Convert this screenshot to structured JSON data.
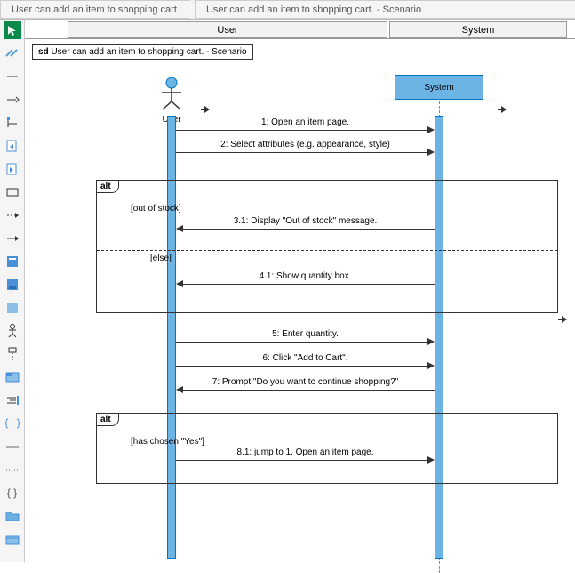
{
  "breadcrumb": {
    "items": [
      {
        "label": "User can add an item to shopping cart."
      },
      {
        "label": "User can add an item to shopping cart. - Scenario"
      }
    ]
  },
  "columns": {
    "left": "User",
    "right": "System"
  },
  "frame": {
    "prefix": "sd",
    "title": "User can add an item to shopping cart. - Scenario"
  },
  "actors": {
    "user": "User",
    "system": "System"
  },
  "fragments": {
    "alt1": {
      "label": "alt",
      "guard1": "[out of stock]",
      "guard2": "[else]"
    },
    "alt2": {
      "label": "alt",
      "guard1": "[has chosen \"Yes\"]"
    }
  },
  "messages": {
    "m1": "1: Open an item page.",
    "m2": "2: Select attributes (e.g. appearance, style)",
    "m3_1": "3.1: Display \"Out of stock\" message.",
    "m4_1": "4.1: Show quantity box.",
    "m5": "5: Enter quantity.",
    "m6": "6: Click \"Add to Cart\".",
    "m7": "7: Prompt \"Do you want to continue shopping?\"",
    "m8_1": "8.1: jump to 1. Open an item page."
  },
  "toolbox": {
    "items": [
      "cursor",
      "ruler",
      "line-tool",
      "arrow-tool",
      "anchor-tool",
      "page-back",
      "page-front",
      "box-tool",
      "dash-arrow",
      "solid-arrow",
      "note-blue",
      "note-dark",
      "note-light",
      "actor-tool",
      "lifeline-tool",
      "fragment-tool",
      "align-tool",
      "braces-tool",
      "line-style",
      "dotted-tool",
      "curly-tool",
      "folder-tool",
      "card-tool"
    ]
  }
}
